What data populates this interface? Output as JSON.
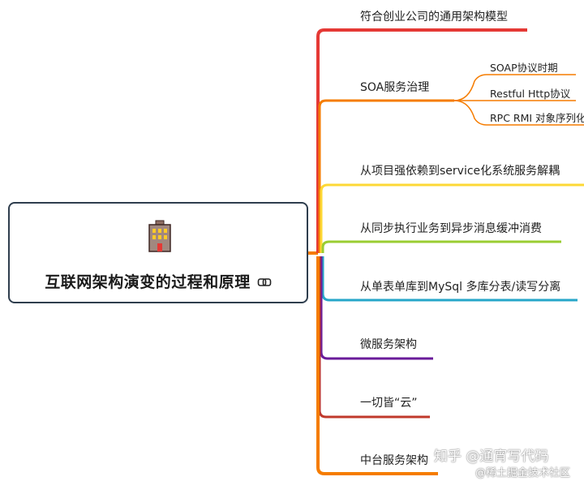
{
  "root": {
    "title": "互联网架构演变的过程和原理",
    "icon": "office-building-icon",
    "link_icon": "link-icon"
  },
  "branches": [
    {
      "label": "符合创业公司的通用架构模型",
      "color": "#e53935"
    },
    {
      "label": "SOA服务治理",
      "color": "#f57c00",
      "children": [
        {
          "label": "SOAP协议时期"
        },
        {
          "label": "Restful Http协议"
        },
        {
          "label": "RPC RMI 对象序列化"
        }
      ]
    },
    {
      "label": "从项目强依赖到service化系统服务解耦",
      "color": "#fdd835"
    },
    {
      "label": "从同步执行业务到异步消息缓冲消费",
      "color": "#9acd32"
    },
    {
      "label": "从单表单库到MySql 多库分表/读写分离",
      "color": "#26a6c9"
    },
    {
      "label": "微服务架构",
      "color": "#6a1b9a"
    },
    {
      "label": "一切皆“云”",
      "color": "#c0392b"
    },
    {
      "label": "中台服务架构",
      "color": "#f57c00"
    }
  ],
  "watermark": {
    "line1": "知乎 @通宵写代码",
    "line2": "@稀土掘金技术社区"
  }
}
